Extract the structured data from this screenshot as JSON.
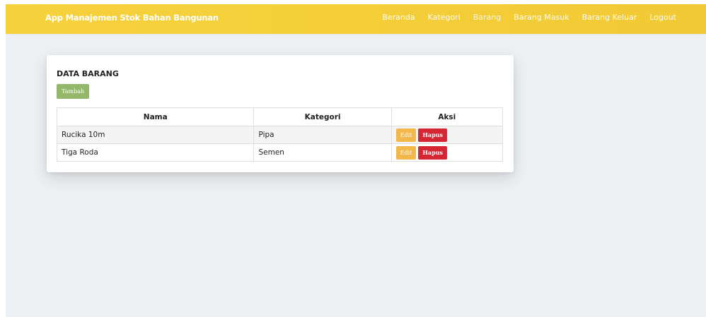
{
  "navbar": {
    "brand": "App Manajemen Stok Bahan Bangunan",
    "links": [
      {
        "label": "Beranda"
      },
      {
        "label": "Kategori"
      },
      {
        "label": "Barang"
      },
      {
        "label": "Barang Masuk"
      },
      {
        "label": "Barang Keluar"
      },
      {
        "label": "Logout"
      }
    ],
    "color": "#f4cf38"
  },
  "card": {
    "title": "DATA BARANG",
    "add_label": "Tambah"
  },
  "table": {
    "headers": [
      "Nama",
      "Kategori",
      "Aksi"
    ],
    "rows": [
      {
        "nama": "Rucika 10m",
        "kategori": "Pipa",
        "edit_label": "Edit",
        "delete_label": "Hapus"
      },
      {
        "nama": "Tiga Roda",
        "kategori": "Semen",
        "edit_label": "Edit",
        "delete_label": "Hapus"
      }
    ]
  },
  "colors": {
    "add_button": "#93b86a",
    "edit_button": "#f3b84b",
    "delete_button": "#d42633",
    "background": "#eef1f4"
  }
}
